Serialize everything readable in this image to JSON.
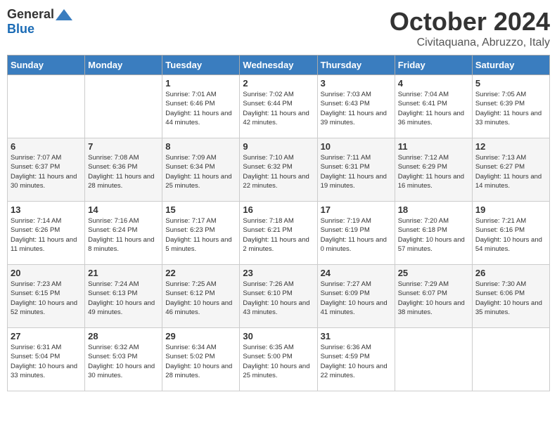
{
  "logo": {
    "general": "General",
    "blue": "Blue"
  },
  "title": "October 2024",
  "location": "Civitaquana, Abruzzo, Italy",
  "days_of_week": [
    "Sunday",
    "Monday",
    "Tuesday",
    "Wednesday",
    "Thursday",
    "Friday",
    "Saturday"
  ],
  "weeks": [
    [
      {
        "day": "",
        "info": ""
      },
      {
        "day": "",
        "info": ""
      },
      {
        "day": "1",
        "info": "Sunrise: 7:01 AM\nSunset: 6:46 PM\nDaylight: 11 hours and 44 minutes."
      },
      {
        "day": "2",
        "info": "Sunrise: 7:02 AM\nSunset: 6:44 PM\nDaylight: 11 hours and 42 minutes."
      },
      {
        "day": "3",
        "info": "Sunrise: 7:03 AM\nSunset: 6:43 PM\nDaylight: 11 hours and 39 minutes."
      },
      {
        "day": "4",
        "info": "Sunrise: 7:04 AM\nSunset: 6:41 PM\nDaylight: 11 hours and 36 minutes."
      },
      {
        "day": "5",
        "info": "Sunrise: 7:05 AM\nSunset: 6:39 PM\nDaylight: 11 hours and 33 minutes."
      }
    ],
    [
      {
        "day": "6",
        "info": "Sunrise: 7:07 AM\nSunset: 6:37 PM\nDaylight: 11 hours and 30 minutes."
      },
      {
        "day": "7",
        "info": "Sunrise: 7:08 AM\nSunset: 6:36 PM\nDaylight: 11 hours and 28 minutes."
      },
      {
        "day": "8",
        "info": "Sunrise: 7:09 AM\nSunset: 6:34 PM\nDaylight: 11 hours and 25 minutes."
      },
      {
        "day": "9",
        "info": "Sunrise: 7:10 AM\nSunset: 6:32 PM\nDaylight: 11 hours and 22 minutes."
      },
      {
        "day": "10",
        "info": "Sunrise: 7:11 AM\nSunset: 6:31 PM\nDaylight: 11 hours and 19 minutes."
      },
      {
        "day": "11",
        "info": "Sunrise: 7:12 AM\nSunset: 6:29 PM\nDaylight: 11 hours and 16 minutes."
      },
      {
        "day": "12",
        "info": "Sunrise: 7:13 AM\nSunset: 6:27 PM\nDaylight: 11 hours and 14 minutes."
      }
    ],
    [
      {
        "day": "13",
        "info": "Sunrise: 7:14 AM\nSunset: 6:26 PM\nDaylight: 11 hours and 11 minutes."
      },
      {
        "day": "14",
        "info": "Sunrise: 7:16 AM\nSunset: 6:24 PM\nDaylight: 11 hours and 8 minutes."
      },
      {
        "day": "15",
        "info": "Sunrise: 7:17 AM\nSunset: 6:23 PM\nDaylight: 11 hours and 5 minutes."
      },
      {
        "day": "16",
        "info": "Sunrise: 7:18 AM\nSunset: 6:21 PM\nDaylight: 11 hours and 2 minutes."
      },
      {
        "day": "17",
        "info": "Sunrise: 7:19 AM\nSunset: 6:19 PM\nDaylight: 11 hours and 0 minutes."
      },
      {
        "day": "18",
        "info": "Sunrise: 7:20 AM\nSunset: 6:18 PM\nDaylight: 10 hours and 57 minutes."
      },
      {
        "day": "19",
        "info": "Sunrise: 7:21 AM\nSunset: 6:16 PM\nDaylight: 10 hours and 54 minutes."
      }
    ],
    [
      {
        "day": "20",
        "info": "Sunrise: 7:23 AM\nSunset: 6:15 PM\nDaylight: 10 hours and 52 minutes."
      },
      {
        "day": "21",
        "info": "Sunrise: 7:24 AM\nSunset: 6:13 PM\nDaylight: 10 hours and 49 minutes."
      },
      {
        "day": "22",
        "info": "Sunrise: 7:25 AM\nSunset: 6:12 PM\nDaylight: 10 hours and 46 minutes."
      },
      {
        "day": "23",
        "info": "Sunrise: 7:26 AM\nSunset: 6:10 PM\nDaylight: 10 hours and 43 minutes."
      },
      {
        "day": "24",
        "info": "Sunrise: 7:27 AM\nSunset: 6:09 PM\nDaylight: 10 hours and 41 minutes."
      },
      {
        "day": "25",
        "info": "Sunrise: 7:29 AM\nSunset: 6:07 PM\nDaylight: 10 hours and 38 minutes."
      },
      {
        "day": "26",
        "info": "Sunrise: 7:30 AM\nSunset: 6:06 PM\nDaylight: 10 hours and 35 minutes."
      }
    ],
    [
      {
        "day": "27",
        "info": "Sunrise: 6:31 AM\nSunset: 5:04 PM\nDaylight: 10 hours and 33 minutes."
      },
      {
        "day": "28",
        "info": "Sunrise: 6:32 AM\nSunset: 5:03 PM\nDaylight: 10 hours and 30 minutes."
      },
      {
        "day": "29",
        "info": "Sunrise: 6:34 AM\nSunset: 5:02 PM\nDaylight: 10 hours and 28 minutes."
      },
      {
        "day": "30",
        "info": "Sunrise: 6:35 AM\nSunset: 5:00 PM\nDaylight: 10 hours and 25 minutes."
      },
      {
        "day": "31",
        "info": "Sunrise: 6:36 AM\nSunset: 4:59 PM\nDaylight: 10 hours and 22 minutes."
      },
      {
        "day": "",
        "info": ""
      },
      {
        "day": "",
        "info": ""
      }
    ]
  ]
}
